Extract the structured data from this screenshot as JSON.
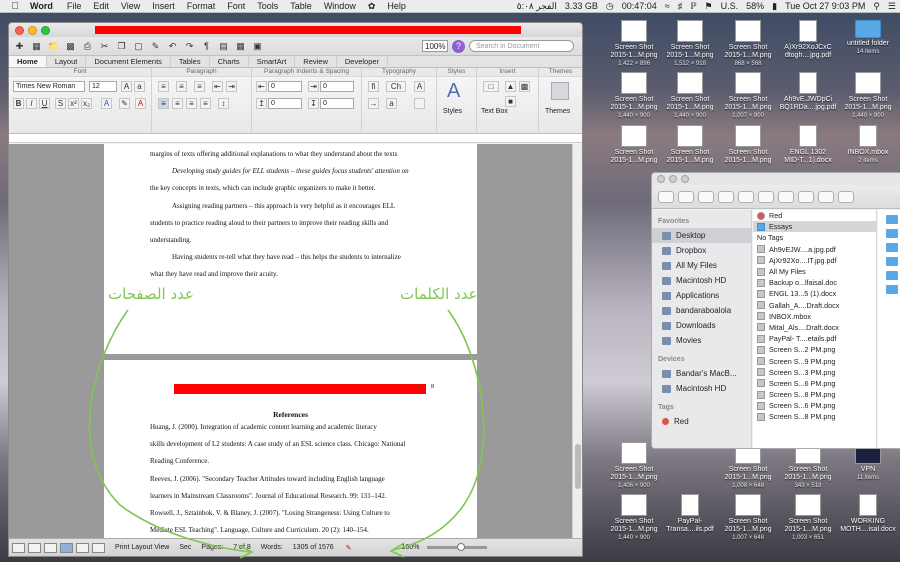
{
  "menubar": {
    "app_name": "Word",
    "items": [
      "File",
      "Edit",
      "View",
      "Insert",
      "Format",
      "Font",
      "Tools",
      "Table",
      "Window",
      "Help"
    ],
    "arabic_prayer": "الفجر ٥:٠٨",
    "memory": "3.33 GB",
    "timer": "00:47:04",
    "input_source": "U.S.",
    "battery": "58%",
    "clock": "Tue Oct 27  9:03 PM"
  },
  "desktop_icons": [
    {
      "name": "Screen Shot",
      "sub": "2015-1...M.png",
      "dims": "1,422 × 896"
    },
    {
      "name": "Screen Shot",
      "sub": "2015-1...M.png",
      "dims": "1,512 × 918"
    },
    {
      "name": "Screen Shot",
      "sub": "2015-1...M.png",
      "dims": "868 × 568"
    },
    {
      "name": "A)Xr92XoJCxC",
      "sub": "dtogh....jpg.pdf",
      "dims": ""
    },
    {
      "name": "untitled folder",
      "sub": "14 items",
      "dims": ""
    },
    {
      "name": "Screen Shot",
      "sub": "2015-1...M.png",
      "dims": "1,440 × 900"
    },
    {
      "name": "Screen Shot",
      "sub": "2015-1...M.png",
      "dims": "1,440 × 900"
    },
    {
      "name": "Screen Shot",
      "sub": "2015-1...M.png",
      "dims": "1,007 × 900"
    },
    {
      "name": "Ah9vE.JWDpCi",
      "sub": "BQ1RDa....jpg.pdf",
      "dims": ""
    },
    {
      "name": "Screen Shot",
      "sub": "2015-1...M.png",
      "dims": "1,440 × 900"
    },
    {
      "name": "Screen Shot",
      "sub": "2015-1...M.png",
      "dims": ""
    },
    {
      "name": "Screen Shot",
      "sub": "2015-1...M.png",
      "dims": ""
    },
    {
      "name": "Screen Shot",
      "sub": "2015-1...M.png",
      "dims": ""
    },
    {
      "name": "ENGL 1302",
      "sub": "MID-T...1).docx",
      "dims": ""
    },
    {
      "name": "INBOX.mbox",
      "sub": "2 items",
      "dims": ""
    },
    {
      "name": "Screen Shot",
      "sub": "2015-1...M.png",
      "dims": "1,406 × 900"
    },
    {
      "name": "Screen Shot",
      "sub": "2015-1...M.png",
      "dims": "1,008 × 648"
    },
    {
      "name": "Screen Shot",
      "sub": "2015-1...M.png",
      "dims": "343 × 518"
    },
    {
      "name": "VPN",
      "sub": "11 items",
      "dims": ""
    },
    {
      "name": "Screen Shot",
      "sub": "2015-1...M.png",
      "dims": "1,440 × 900"
    },
    {
      "name": "PayPal-",
      "sub": "Transa....ils.pdf",
      "dims": ""
    },
    {
      "name": "Screen Shot",
      "sub": "2015-1...M.png",
      "dims": "1,007 × 648"
    },
    {
      "name": "Screen Shot",
      "sub": "2015-1...M.png",
      "dims": "1,003 × 651"
    },
    {
      "name": "WORKING",
      "sub": "MOTH....isal.docx",
      "dims": ""
    }
  ],
  "word": {
    "zoom": "100%",
    "search_placeholder": "Search in Document",
    "tabs": [
      "Home",
      "Layout",
      "Document Elements",
      "Tables",
      "Charts",
      "SmartArt",
      "Review",
      "Developer"
    ],
    "groups": {
      "font": "Font",
      "paragraph": "Paragraph",
      "indents": "Paragraph Indents & Spacing",
      "typography": "Typography",
      "styles": "Styles",
      "insert": "Insert",
      "themes": "Themes"
    },
    "font_name": "Times New Roman",
    "font_size": "12",
    "indent_left": "0",
    "indent_right": "0",
    "spacing_before": "0",
    "spacing_after": "0",
    "styles_label": "Styles",
    "textbox_label": "Text Box",
    "themes_label": "Themes",
    "page1": [
      {
        "cls": "",
        "text": "margins of texts offering additional explanations to what they understand about the texts"
      },
      {
        "cls": "ind",
        "text": "Developing study guides for ELL students – these guides focus students' attention on"
      },
      {
        "cls": "",
        "text": "the key concepts in texts, which can include graphic organizers to make it better."
      },
      {
        "cls": "ind",
        "text": "Assigning reading partners – this approach is very helpful as it encourages ELL"
      },
      {
        "cls": "",
        "text": "students to practice reading aloud to their partners to improve their reading skills and"
      },
      {
        "cls": "",
        "text": "understanding."
      },
      {
        "cls": "ind",
        "text": "Having students re-tell what they have read – this helps the students to internalize"
      },
      {
        "cls": "",
        "text": "what they have read and improve their acuity."
      }
    ],
    "page2_number": "8",
    "references_title": "References",
    "references": [
      "Huang, J. (2000). Integration of academic content learning and academic literacy",
      "skills      development of L2 students: A case study of an ESL science class. Chicago: National",
      "   Reading Conference.",
      "      Reeves, J. (2006). \"Secondary Teacher Attitudes toward including English language",
      "learners in     Mainstream Classrooms\". Journal of Educational Research. 99: 131–142.",
      "      Rowsell, J., Sztainbok, V. & Blaney, J. (2007). \"Losing Strangeness: Using Culture to",
      "Mediate     ESL Teaching\". Language, Culture and Curriculum. 20 (2): 140–154."
    ],
    "status": {
      "view": "Print Layout View",
      "sec": "Sec",
      "pages_label": "Pages:",
      "pages_value": "7 of 8",
      "words_label": "Words:",
      "words_value": "1305 of 1576",
      "zoom": "100%"
    }
  },
  "annotations": {
    "pages_arabic": "عدد الصفحات",
    "words_arabic": "عدد الكلمات",
    "color": "#7ec850"
  },
  "finder": {
    "favorites_header": "Favorites",
    "devices_header": "Devices",
    "tags_header": "Tags",
    "favorites": [
      "Desktop",
      "Dropbox",
      "All My Files",
      "Macintosh HD",
      "Applications",
      "bandaraboalola",
      "Downloads",
      "Movies"
    ],
    "devices": [
      "Bandar's MacB...",
      "Macintosh HD"
    ],
    "tags": [
      "Red"
    ],
    "col_tag": "Red",
    "col_folder": "Essays",
    "col_no_tags": "No Tags",
    "files": [
      "Ah9vEJW....a.jpg.pdf",
      "AjXr92Xo....IT.jpg.pdf",
      "All My Files",
      "Backup o...lfaisal.doc",
      "ENGL 13...5 (1).docx",
      "Gallah_A....Draft.docx",
      "INBOX.mbox",
      "Mital_Als....Draft.docx",
      "PayPal- T....etails.pdf",
      "Screen S...2 PM.png",
      "Screen S...9 PM.png",
      "Screen S...3 PM.png",
      "Screen S...6 PM.png",
      "Screen S...8 PM.png",
      "Screen S...6 PM.png",
      "Screen S...8 PM.png"
    ]
  }
}
